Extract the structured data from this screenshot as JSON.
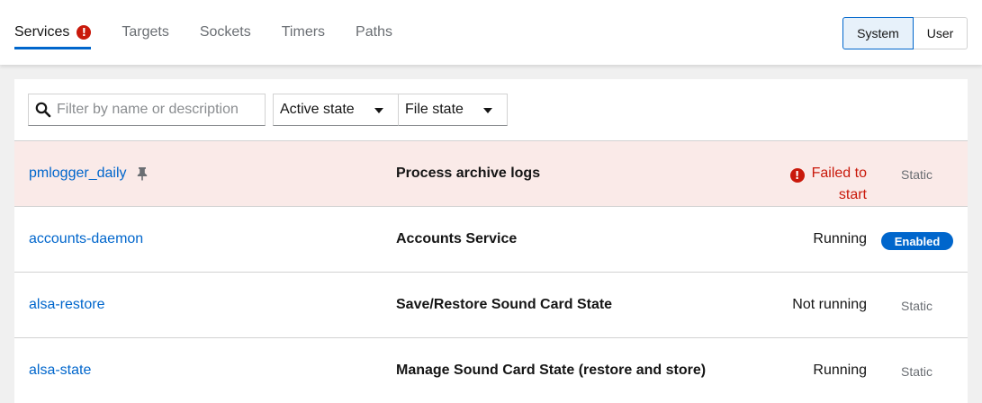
{
  "tabs": [
    {
      "label": "Services",
      "active": true,
      "has_error": true
    },
    {
      "label": "Targets"
    },
    {
      "label": "Sockets"
    },
    {
      "label": "Timers"
    },
    {
      "label": "Paths"
    }
  ],
  "scope": {
    "system_label": "System",
    "user_label": "User",
    "selected": "System"
  },
  "filter": {
    "search_placeholder": "Filter by name or description",
    "active_state_label": "Active state",
    "file_state_label": "File state"
  },
  "units": [
    {
      "name": "pmlogger_daily",
      "pinned": true,
      "description": "Process archive logs",
      "state": "Failed to start",
      "state_type": "error",
      "file_state": "Static"
    },
    {
      "name": "accounts-daemon",
      "pinned": false,
      "description": "Accounts Service",
      "state": "Running",
      "state_type": "normal",
      "file_state": "Enabled"
    },
    {
      "name": "alsa-restore",
      "pinned": false,
      "description": "Save/Restore Sound Card State",
      "state": "Not running",
      "state_type": "normal",
      "file_state": "Static"
    },
    {
      "name": "alsa-state",
      "pinned": false,
      "description": "Manage Sound Card State (restore and store)",
      "state": "Running",
      "state_type": "normal",
      "file_state": "Static"
    }
  ],
  "colors": {
    "link": "#0066cc",
    "error": "#c9190b",
    "failed_row_bg": "#faeae8",
    "enabled_badge": "#0066cc"
  },
  "icons": {
    "tab_error": "exclamation-circle-icon",
    "search": "search-icon",
    "pin": "thumbtack-icon",
    "caret": "caret-down-icon"
  }
}
